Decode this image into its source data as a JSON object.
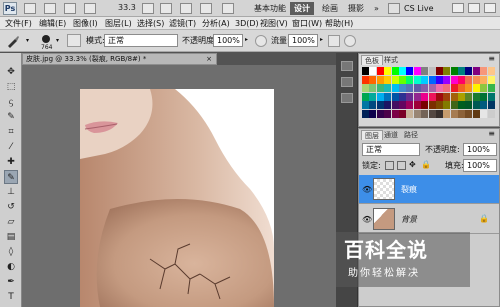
{
  "titlebar": {
    "logo": "Ps",
    "zoom": "33.3",
    "workspaces": [
      "基本功能",
      "设计",
      "绘画",
      "摄影"
    ],
    "active_workspace": "设计",
    "more": "»",
    "cslive": "CS Live"
  },
  "menubar": {
    "items": [
      "文件(F)",
      "编辑(E)",
      "图像(I)",
      "图层(L)",
      "选择(S)",
      "滤镜(T)",
      "分析(A)",
      "3D(D)",
      "视图(V)",
      "窗口(W)",
      "帮助(H)"
    ]
  },
  "options": {
    "brush_size": "764",
    "mode_label": "模式:",
    "mode_value": "正常",
    "opacity_label": "不透明度:",
    "opacity_value": "100%",
    "flow_label": "流量:",
    "flow_value": "100%"
  },
  "document": {
    "tab_title": "皮肤.jpg @ 33.3% (裂痕, RGB/8#) *",
    "close": "×"
  },
  "swatches": {
    "tabs": [
      "色板",
      "样式"
    ],
    "colors": [
      "#000000",
      "#ffffff",
      "#ff0000",
      "#ffff00",
      "#00ff00",
      "#00ffff",
      "#0000ff",
      "#ff00ff",
      "#808080",
      "#c0c0c0",
      "#800000",
      "#808000",
      "#008000",
      "#008080",
      "#000080",
      "#800080",
      "#f7977a",
      "#fdc68a",
      "#ff3300",
      "#ff6600",
      "#ff9900",
      "#ffcc00",
      "#ccff00",
      "#66ff00",
      "#00ff66",
      "#00ffcc",
      "#00ccff",
      "#0066ff",
      "#3300ff",
      "#9900ff",
      "#ff00cc",
      "#ff0066",
      "#f26c4f",
      "#f68e55",
      "#fbaf5d",
      "#fff568",
      "#acd372",
      "#7cc576",
      "#3bb878",
      "#1abbb4",
      "#00bff3",
      "#438ccb",
      "#5574b9",
      "#605ca8",
      "#855fa8",
      "#a763a8",
      "#f06ea9",
      "#f26d7d",
      "#ed1c24",
      "#f26522",
      "#f7941d",
      "#fff200",
      "#8dc63f",
      "#39b54a",
      "#00a651",
      "#00a99d",
      "#00aeef",
      "#0072bc",
      "#0054a6",
      "#2e3192",
      "#662d91",
      "#92278f",
      "#ec008c",
      "#ed145b",
      "#9e0b0f",
      "#a0410d",
      "#a3620a",
      "#aba000",
      "#598527",
      "#1a7b30",
      "#007236",
      "#00746b",
      "#0076a3",
      "#004a80",
      "#003471",
      "#1b1464",
      "#440e62",
      "#630460",
      "#9e005d",
      "#9e0039",
      "#790000",
      "#7b2e00",
      "#7d4900",
      "#827b00",
      "#406618",
      "#005e20",
      "#005826",
      "#005952",
      "#005b7f",
      "#003663",
      "#002157",
      "#0d004c",
      "#32004b",
      "#4b0049",
      "#7b0046",
      "#7a0026",
      "#c7b299",
      "#998675",
      "#736357",
      "#534741",
      "#372f2c",
      "#c69c6d",
      "#a67c52",
      "#8c6239",
      "#754c24",
      "#603913",
      "#e6e6e6",
      "#cccccc"
    ]
  },
  "layers": {
    "tabs": [
      "图层",
      "通道",
      "路径"
    ],
    "blend_mode": "正常",
    "opacity_label": "不透明度:",
    "opacity_value": "100%",
    "lock_label": "锁定:",
    "fill_label": "填充:",
    "fill_value": "100%",
    "items": [
      {
        "name": "裂痕",
        "selected": true
      },
      {
        "name": "背景",
        "selected": false
      }
    ]
  },
  "watermark": {
    "title": "百科全说",
    "subtitle": "助你轻松解决"
  },
  "colors": {
    "selected_layer": "#3d8ee8",
    "active_workspace": "#5c5c5c"
  }
}
